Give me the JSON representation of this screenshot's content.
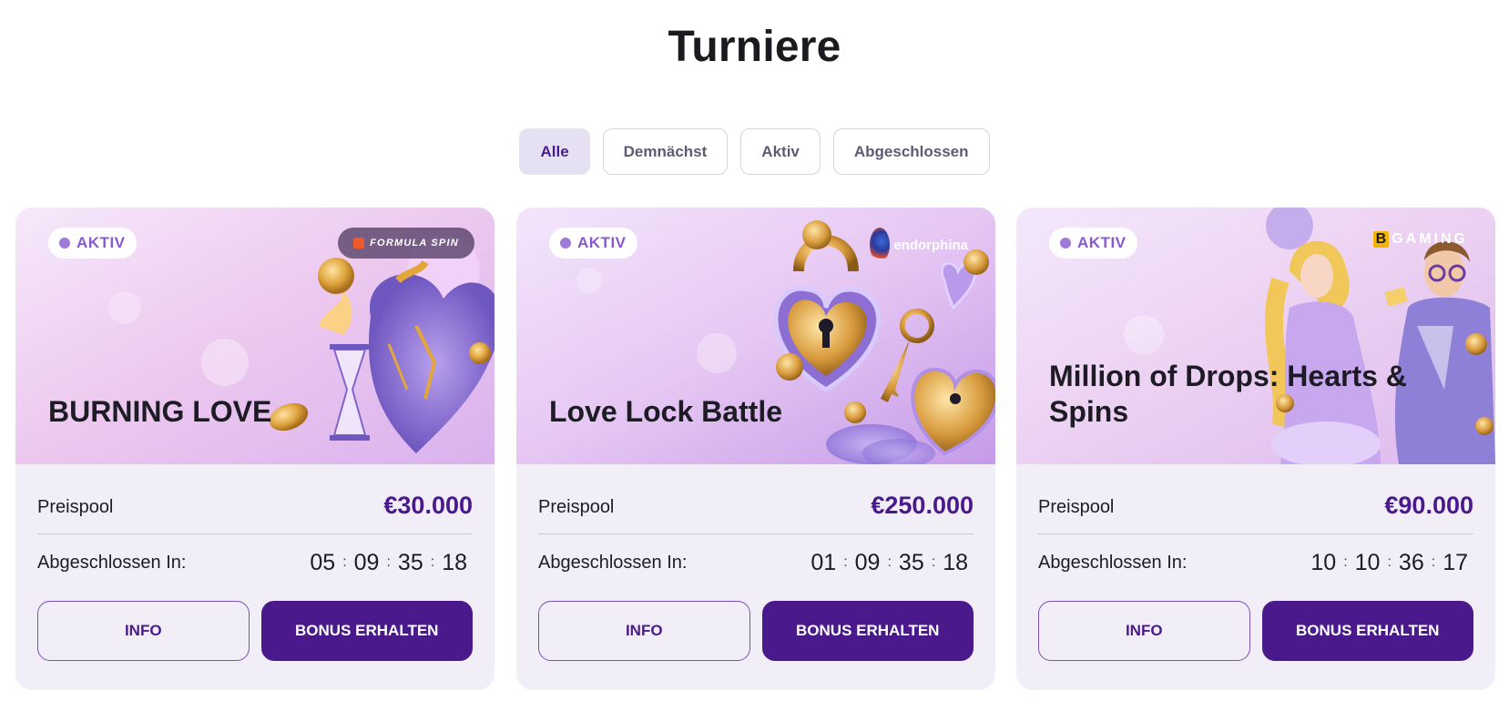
{
  "page": {
    "title": "Turniere"
  },
  "filters": [
    {
      "label": "Alle",
      "active": true
    },
    {
      "label": "Demnächst",
      "active": false
    },
    {
      "label": "Aktiv",
      "active": false
    },
    {
      "label": "Abgeschlossen",
      "active": false
    }
  ],
  "cards": [
    {
      "status": "AKTIV",
      "provider": "FORMULA SPIN",
      "title": "BURNING LOVE",
      "pool_label": "Preispool",
      "pool_value": "€30.000",
      "timer_label": "Abgeschlossen In:",
      "timer": {
        "d": "05",
        "h": "09",
        "m": "35",
        "s": "18"
      },
      "info_label": "INFO",
      "bonus_label": "BONUS ERHALTEN"
    },
    {
      "status": "AKTIV",
      "provider": "endorphina",
      "title": "Love Lock Battle",
      "pool_label": "Preispool",
      "pool_value": "€250.000",
      "timer_label": "Abgeschlossen In:",
      "timer": {
        "d": "01",
        "h": "09",
        "m": "35",
        "s": "18"
      },
      "info_label": "INFO",
      "bonus_label": "BONUS ERHALTEN"
    },
    {
      "status": "AKTIV",
      "provider": "GAMING",
      "provider_mark": "B",
      "title": "Million of Drops: Hearts & Spins",
      "pool_label": "Preispool",
      "pool_value": "€90.000",
      "timer_label": "Abgeschlossen In:",
      "timer": {
        "d": "10",
        "h": "10",
        "m": "36",
        "s": "17"
      },
      "info_label": "INFO",
      "bonus_label": "BONUS ERHALTEN"
    }
  ],
  "colors": {
    "accent": "#4a1a8c",
    "status": "#8a57d0",
    "card_bg": "#f1eef8",
    "filter_active_bg": "#e6e1f2"
  }
}
